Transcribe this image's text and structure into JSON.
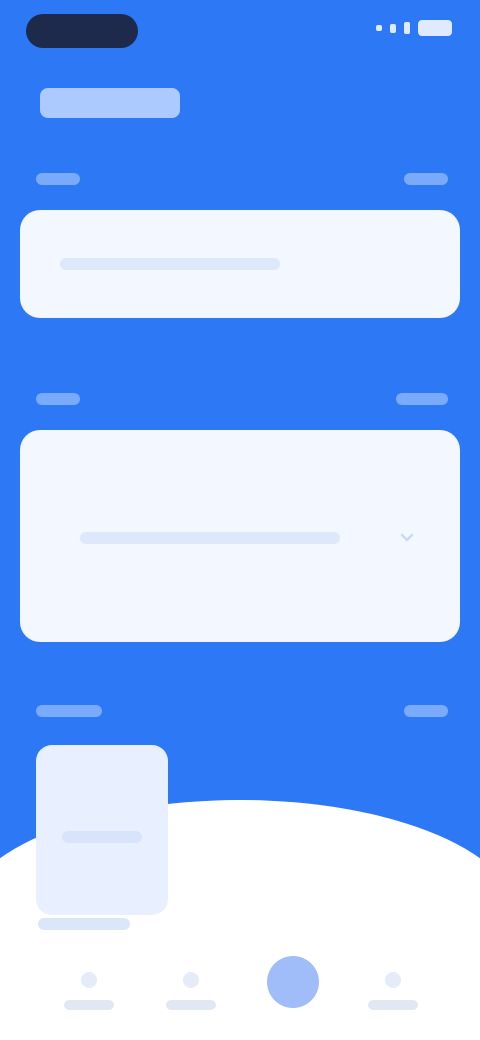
{
  "colors": {
    "primary_blue": "#2c78f5",
    "card_bg": "#f3f7ff",
    "white": "#ffffff"
  },
  "icons": {
    "chevron": "chevron-down-icon",
    "battery": "battery-icon",
    "signal": "signal-icon"
  }
}
